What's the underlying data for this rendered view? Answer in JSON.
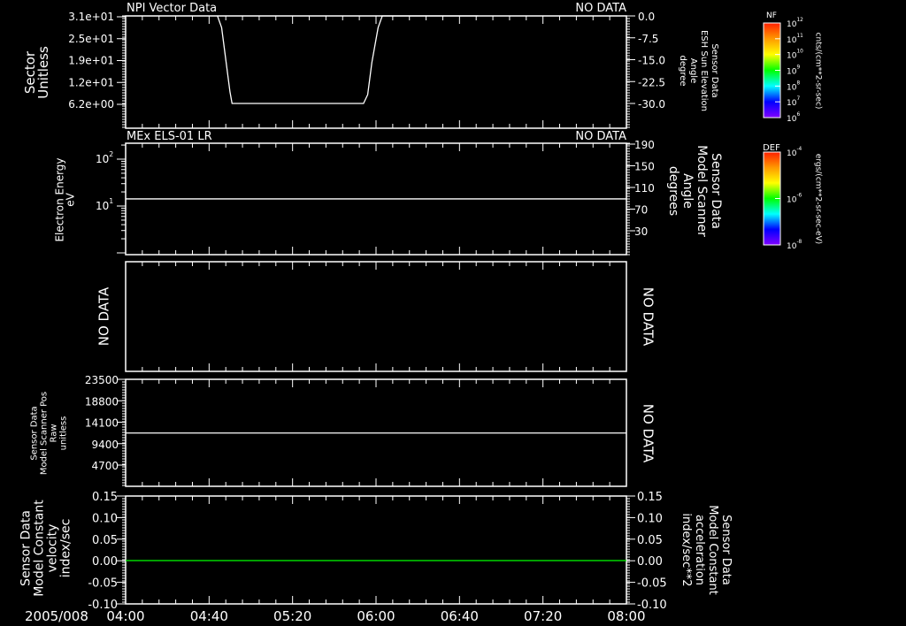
{
  "date_label": "2005/008",
  "time_axis": {
    "ticks": [
      "04:00",
      "04:40",
      "05:20",
      "06:00",
      "06:40",
      "07:20",
      "08:00"
    ],
    "range": [
      "04:00",
      "08:00"
    ]
  },
  "colors": {
    "line": "#ffffff",
    "accent_green": "#00ff00",
    "background": "#000000"
  },
  "colorbars": [
    {
      "title": "NF",
      "unit": "cnts/(cm**2-sr-sec)",
      "tick_labels": [
        {
          "base": "10",
          "exp": "12"
        },
        {
          "base": "10",
          "exp": "11"
        },
        {
          "base": "10",
          "exp": "10"
        },
        {
          "base": "10",
          "exp": "9"
        },
        {
          "base": "10",
          "exp": "8"
        },
        {
          "base": "10",
          "exp": "7"
        },
        {
          "base": "10",
          "exp": "6"
        }
      ],
      "colors": [
        "#ff2000",
        "#ff9900",
        "#ffff00",
        "#00ff00",
        "#00ffff",
        "#0000ff",
        "#8000ff"
      ]
    },
    {
      "title": "DEF",
      "unit": "ergs/(cm**2-sr-sec-eV)",
      "tick_labels": [
        {
          "base": "10",
          "exp": "-4"
        },
        {
          "base": "10",
          "exp": "-6"
        },
        {
          "base": "10",
          "exp": "-8"
        }
      ],
      "colors": [
        "#ff2000",
        "#ff9900",
        "#ffff00",
        "#00ff00",
        "#00ffff",
        "#0000ff",
        "#8000ff"
      ]
    }
  ],
  "chart_data": [
    {
      "type": "line",
      "title": "NPI Vector Data",
      "status": "NO DATA",
      "ylabel": [
        "Sector",
        "Unitless"
      ],
      "yticks": [
        "3.1e+01",
        "2.5e+01",
        "1.9e+01",
        "1.2e+01",
        "6.2e+00"
      ],
      "ylabel_right": [
        "Sensor Data",
        "ESH Sun Elevation",
        "Angle",
        "degree"
      ],
      "yticks_right": [
        "0.0",
        "-7.5",
        "-15.0",
        "-22.5",
        "-30.0"
      ],
      "ylim_right": [
        -38.5,
        0.3
      ],
      "series": [
        {
          "color": "#ffffff",
          "x": [
            "04:44",
            "04:46",
            "04:48",
            "04:50",
            "04:51",
            "05:54",
            "05:56",
            "05:58",
            "06:01",
            "06:03",
            "06:49"
          ],
          "y": [
            0,
            -4,
            -15,
            -26,
            -30,
            -30,
            -27,
            -16,
            -4,
            0,
            0
          ]
        }
      ]
    },
    {
      "type": "line",
      "title": "MEx ELS-01 LR",
      "status": "NO DATA",
      "ylabel": [
        "Electron Energy",
        "eV"
      ],
      "yscale": "log",
      "yticks": [
        {
          "base": "10",
          "exp": "2"
        },
        {
          "base": "10",
          "exp": "1"
        }
      ],
      "ylim": [
        0.92,
        218
      ],
      "ylabel_right": [
        "Sensor Data",
        "Model Scanner",
        "Angle",
        "degrees"
      ],
      "yticks_right": [
        "190",
        "150",
        "110",
        "70",
        "30"
      ],
      "series": [
        {
          "color": "#ffffff",
          "x": [
            "04:00",
            "08:00"
          ],
          "y": [
            14.2,
            14.2
          ]
        }
      ]
    },
    {
      "type": "line",
      "left_text": "NO DATA",
      "right_text": "NO DATA",
      "series": []
    },
    {
      "type": "line",
      "ylabel": [
        "Sensor Data",
        "Model Scanner Pos",
        "Raw",
        "unitless"
      ],
      "yticks": [
        "23500",
        "18800",
        "14100",
        "9400",
        "4700"
      ],
      "ylim": [
        0,
        23500
      ],
      "right_text": "NO DATA",
      "series": [
        {
          "color": "#ffffff",
          "x": [
            "04:00",
            "08:00"
          ],
          "y": [
            11700,
            11700
          ]
        }
      ]
    },
    {
      "type": "line",
      "ylabel": [
        "Sensor Data",
        "Model Constant",
        "velocity",
        "index/sec"
      ],
      "yticks": [
        "0.15",
        "0.10",
        "0.05",
        "0.00",
        "-0.05",
        "-0.10"
      ],
      "ylim": [
        -0.1,
        0.15
      ],
      "ylabel_right": [
        "Sensor Data",
        "Model Constant",
        "acceleration",
        "index/sec**2"
      ],
      "yticks_right": [
        "0.15",
        "0.10",
        "0.05",
        "0.00",
        "-0.05",
        "-0.10"
      ],
      "series": [
        {
          "color": "#00ff00",
          "x": [
            "04:00",
            "08:00"
          ],
          "y": [
            0,
            0
          ]
        }
      ]
    }
  ]
}
